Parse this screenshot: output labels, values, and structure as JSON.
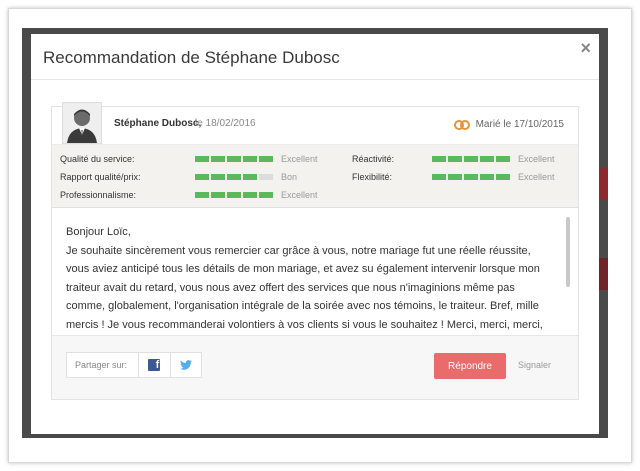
{
  "modal": {
    "title": "Recommandation de Stéphane Dubosc",
    "close": "×"
  },
  "review": {
    "author": "Stéphane Dubosc,",
    "date": "le 18/02/2016",
    "married": "Marié le 17/10/2015",
    "ratings_left": [
      {
        "label": "Qualité du service:",
        "score": 5,
        "value": "Excellent"
      },
      {
        "label": "Rapport qualité/prix:",
        "score": 4,
        "value": "Bon"
      },
      {
        "label": "Professionnalisme:",
        "score": 5,
        "value": "Excellent"
      }
    ],
    "ratings_right": [
      {
        "label": "Réactivité:",
        "score": 5,
        "value": "Excellent"
      },
      {
        "label": "Flexibilité:",
        "score": 5,
        "value": "Excellent"
      }
    ],
    "text": [
      "Bonjour Loïc,",
      "Je souhaite sincèrement vous remercier car grâce à vous, notre mariage fut une réelle réussite, vous aviez anticipé tous les détails de mon mariage, et avez su également intervenir lorsque mon traiteur avait du retard, vous nous avez offert des services que nous n'imaginions même pas comme, globalement, l'organisation intégrale de la soirée avec nos témoins, le traiteur. Bref, mille mercis ! Je vous recommanderai volontiers à vos clients si vous le souhaitez ! Merci, merci, merci,"
    ]
  },
  "footer": {
    "share_label": "Partager sur:",
    "reply_label": "Répondre",
    "report_label": "Signaler"
  },
  "colors": {
    "accent_green": "#5cb85c",
    "reply_red": "#e96b6b",
    "facebook": "#3b5998",
    "twitter": "#55acee",
    "rings": "#e6933a"
  }
}
